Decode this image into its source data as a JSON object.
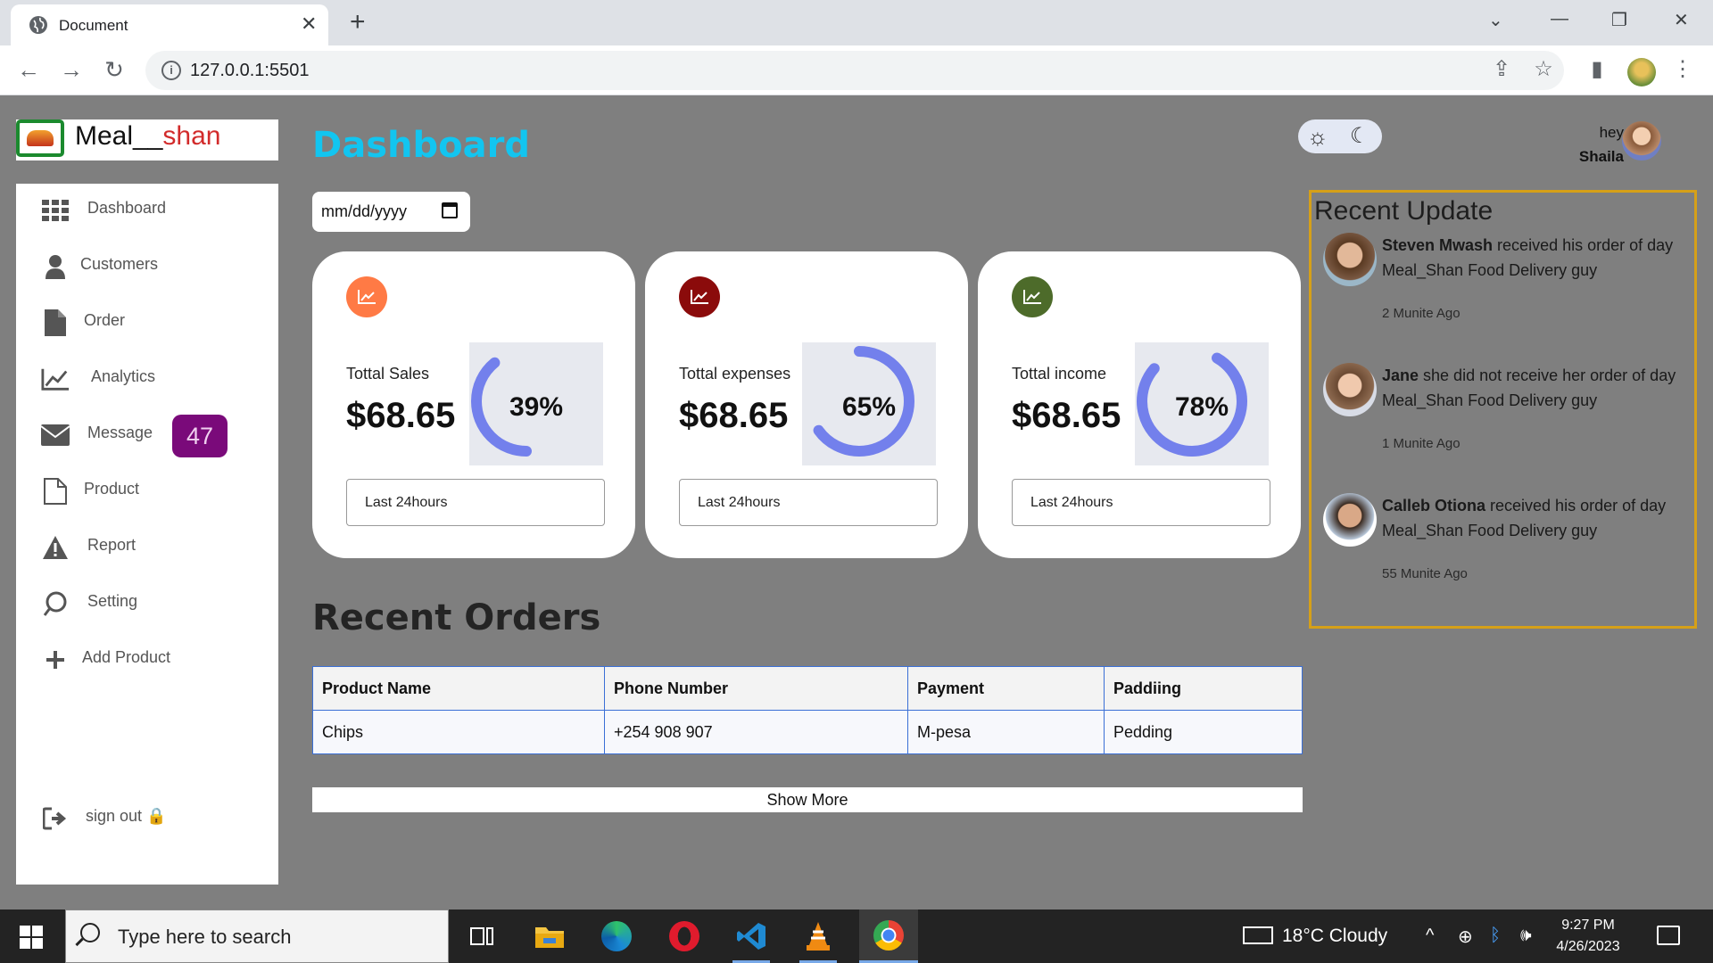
{
  "browser": {
    "tab_title": "Document",
    "url": "127.0.0.1:5501",
    "icons": [
      "globe-icon",
      "close-icon",
      "plus-icon",
      "back-icon",
      "forward-icon",
      "reload-icon",
      "info-icon",
      "share-icon",
      "star-icon",
      "side-panel-icon",
      "more-icon"
    ]
  },
  "app": {
    "logo_prefix": "Meal__",
    "logo_accent": "shan",
    "page_title": "Dashboard",
    "date_placeholder": "mm/dd/yyyy",
    "profile": {
      "greeting": "hey",
      "name": "Shaila"
    }
  },
  "sidebar": {
    "items": [
      {
        "label": "Dashboard",
        "icon": "grid-icon"
      },
      {
        "label": "Customers",
        "icon": "person-icon"
      },
      {
        "label": "Order",
        "icon": "file-icon"
      },
      {
        "label": "Analytics",
        "icon": "chart-line-icon"
      },
      {
        "label": "Message",
        "icon": "envelope-icon"
      },
      {
        "label": "Product",
        "icon": "document-icon"
      },
      {
        "label": "Report",
        "icon": "warning-icon"
      },
      {
        "label": "Setting",
        "icon": "settings-icon"
      },
      {
        "label": "Add Product",
        "icon": "plus-icon"
      },
      {
        "label": "sign out 🔒",
        "icon": "sign-out-icon"
      }
    ],
    "message_count": "47"
  },
  "cards": [
    {
      "label": "Tottal Sales",
      "value": "$68.65",
      "percent": "39%",
      "percent_value": 39,
      "period": "Last 24hours",
      "icon_color": "#ff7a45"
    },
    {
      "label": "Tottal expenses",
      "value": "$68.65",
      "percent": "65%",
      "percent_value": 65,
      "period": "Last 24hours",
      "icon_color": "#8b0b0b"
    },
    {
      "label": "Tottal income",
      "value": "$68.65",
      "percent": "78%",
      "percent_value": 78,
      "period": "Last 24hours",
      "icon_color": "#4d6b2a"
    }
  ],
  "ring_color": "#7380ec",
  "orders": {
    "title": "Recent Orders",
    "headers": [
      "Product Name",
      "Phone Number",
      "Payment",
      "Paddiing"
    ],
    "rows": [
      [
        "Chips",
        "+254 908 907",
        "M-pesa",
        "Pedding"
      ]
    ],
    "show_more": "Show More"
  },
  "recent_update": {
    "title": "Recent Update",
    "items": [
      {
        "name": "Steven Mwash",
        "text": " received his order of day Meal_Shan Food Delivery guy",
        "time": "2 Munite Ago"
      },
      {
        "name": "Jane",
        "text": " she did not receive her order of day Meal_Shan Food Delivery guy",
        "time": "1 Munite Ago"
      },
      {
        "name": "Calleb Otiona",
        "text": " received his order of day Meal_Shan Food Delivery guy",
        "time": "55 Munite Ago"
      }
    ]
  },
  "taskbar": {
    "search_placeholder": "Type here to search",
    "weather": "18°C  Cloudy",
    "time": "9:27 PM",
    "date": "4/26/2023"
  }
}
